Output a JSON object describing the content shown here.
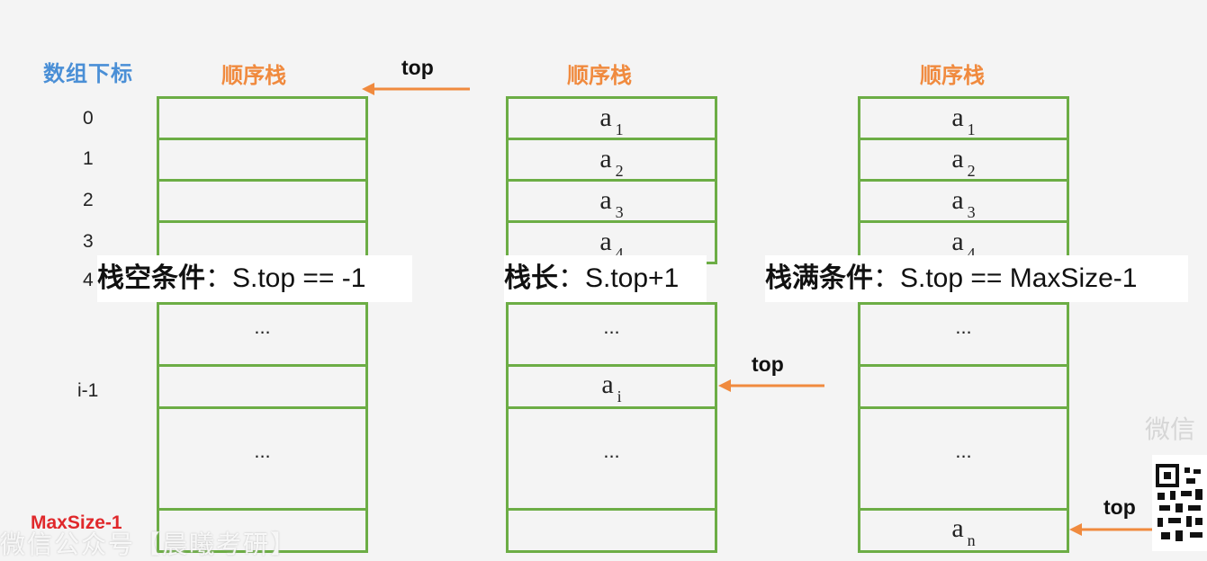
{
  "index_title": "数组下标",
  "stack_title": "顺序栈",
  "indices": [
    "0",
    "1",
    "2",
    "3",
    "4",
    "i-1"
  ],
  "maxsize_label": "MaxSize-1",
  "top_label": "top",
  "ellipsis": "...",
  "cells_a": [
    "a",
    "a",
    "a",
    "a"
  ],
  "subs": [
    "1",
    "2",
    "3",
    "4"
  ],
  "ai_base": "a",
  "ai_sub": "i",
  "an_base": "a",
  "an_sub": "n",
  "conditions": {
    "empty_bold": "栈空条件",
    "empty_rest": "：S.top == -1",
    "length_bold": "栈长",
    "length_rest": "：S.top+1",
    "full_bold": "栈满条件",
    "full_rest": "：S.top == MaxSize-1"
  },
  "watermark_text": "微信公众号【晨曦考研】",
  "watermark_right": "微信",
  "colors": {
    "border": "#6cad45",
    "arrow": "#f08a3e",
    "index_title": "#4a8fd6",
    "maxsize": "#e0282b"
  }
}
